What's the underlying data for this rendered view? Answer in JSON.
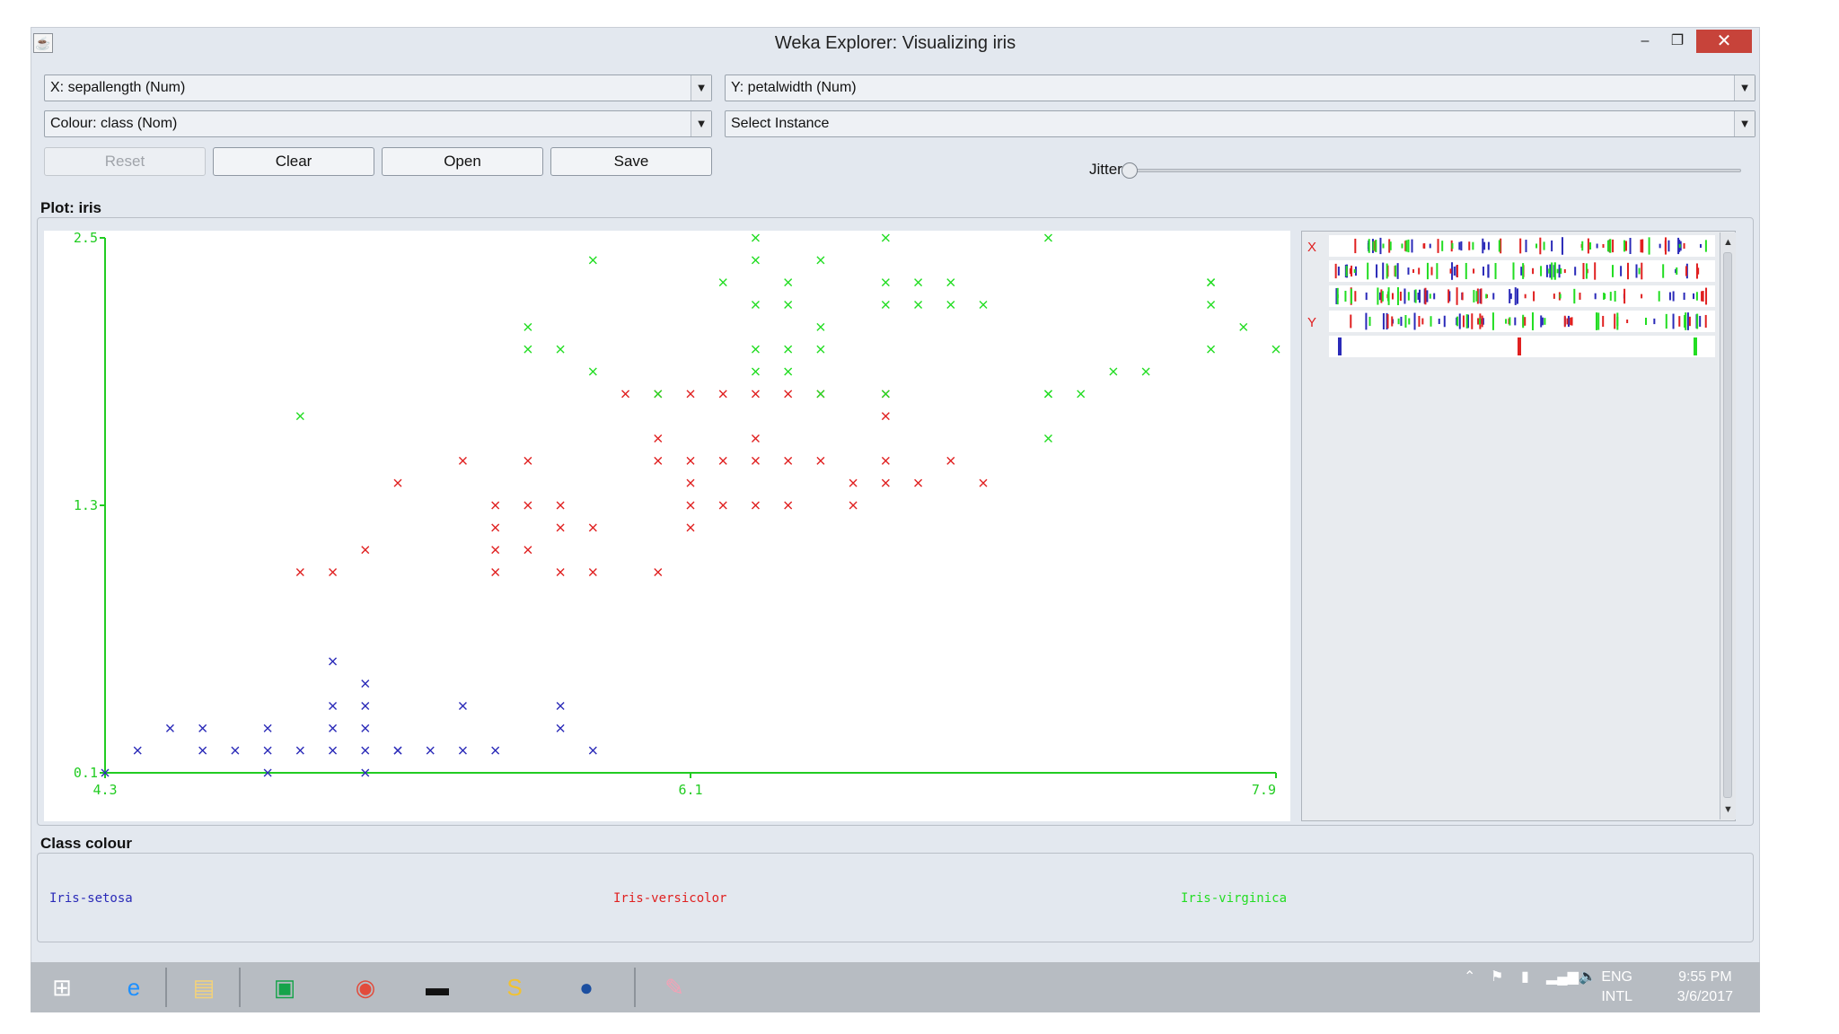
{
  "window": {
    "title": "Weka Explorer: Visualizing iris"
  },
  "controls": {
    "x_axis": "X: sepallength (Num)",
    "y_axis": "Y: petalwidth (Num)",
    "colour": "Colour: class (Nom)",
    "instance": "Select Instance",
    "buttons": {
      "reset": "Reset",
      "clear": "Clear",
      "open": "Open",
      "save": "Save"
    },
    "jitter_label": "Jitter",
    "jitter_value": 0
  },
  "plot": {
    "label": "Plot: iris"
  },
  "side": {
    "x_label": "X",
    "y_label": "Y"
  },
  "legend": {
    "title": "Class colour",
    "classes": [
      {
        "name": "Iris-setosa",
        "color": "#2a2ab8"
      },
      {
        "name": "Iris-versicolor",
        "color": "#e02020"
      },
      {
        "name": "Iris-virginica",
        "color": "#22dd22"
      }
    ]
  },
  "colors": {
    "axis": "#22cc22",
    "setosa": "#2a2ab8",
    "versicolor": "#e02020",
    "virginica": "#22dd22"
  },
  "taskbar": {
    "icons": [
      "windows-start-icon",
      "internet-explorer-icon",
      "file-explorer-icon",
      "store-icon",
      "chrome-icon",
      "cmd-icon",
      "slides-icon",
      "weka-bird-icon",
      "paint-icon"
    ],
    "lang": "ENG",
    "lang2": "INTL",
    "time": "9:55 PM",
    "date": "3/6/2017"
  },
  "chart_data": {
    "type": "scatter",
    "xlim": [
      4.3,
      7.9
    ],
    "ylim": [
      0.1,
      2.5
    ],
    "x_ticks": [
      "4.3",
      "6.1",
      "7.9"
    ],
    "y_ticks": [
      "2.5",
      "1.3",
      "0.1"
    ],
    "marker": "x",
    "series": [
      {
        "name": "Iris-setosa",
        "points": [
          [
            4.3,
            0.1
          ],
          [
            4.8,
            0.1
          ],
          [
            5.1,
            0.1
          ],
          [
            5.2,
            0.2
          ],
          [
            4.4,
            0.2
          ],
          [
            4.6,
            0.2
          ],
          [
            4.7,
            0.2
          ],
          [
            4.8,
            0.2
          ],
          [
            4.9,
            0.2
          ],
          [
            5.0,
            0.2
          ],
          [
            5.1,
            0.2
          ],
          [
            5.2,
            0.2
          ],
          [
            5.3,
            0.2
          ],
          [
            5.4,
            0.2
          ],
          [
            5.5,
            0.2
          ],
          [
            5.8,
            0.2
          ],
          [
            4.5,
            0.3
          ],
          [
            4.6,
            0.3
          ],
          [
            4.8,
            0.3
          ],
          [
            5.0,
            0.3
          ],
          [
            5.1,
            0.3
          ],
          [
            5.7,
            0.3
          ],
          [
            5.0,
            0.4
          ],
          [
            5.1,
            0.4
          ],
          [
            5.4,
            0.4
          ],
          [
            5.7,
            0.4
          ],
          [
            5.1,
            0.5
          ],
          [
            5.0,
            0.6
          ]
        ]
      },
      {
        "name": "Iris-versicolor",
        "points": [
          [
            4.9,
            1.0
          ],
          [
            5.0,
            1.0
          ],
          [
            5.5,
            1.0
          ],
          [
            5.7,
            1.0
          ],
          [
            5.8,
            1.0
          ],
          [
            6.0,
            1.0
          ],
          [
            5.1,
            1.1
          ],
          [
            5.5,
            1.1
          ],
          [
            5.6,
            1.1
          ],
          [
            5.5,
            1.2
          ],
          [
            5.7,
            1.2
          ],
          [
            5.8,
            1.2
          ],
          [
            6.1,
            1.2
          ],
          [
            5.5,
            1.3
          ],
          [
            5.6,
            1.3
          ],
          [
            5.7,
            1.3
          ],
          [
            6.1,
            1.3
          ],
          [
            6.2,
            1.3
          ],
          [
            6.3,
            1.3
          ],
          [
            6.4,
            1.3
          ],
          [
            6.6,
            1.3
          ],
          [
            5.2,
            1.4
          ],
          [
            6.1,
            1.4
          ],
          [
            6.6,
            1.4
          ],
          [
            6.7,
            1.4
          ],
          [
            6.8,
            1.4
          ],
          [
            7.0,
            1.4
          ],
          [
            5.4,
            1.5
          ],
          [
            5.6,
            1.5
          ],
          [
            6.0,
            1.5
          ],
          [
            6.1,
            1.5
          ],
          [
            6.2,
            1.5
          ],
          [
            6.3,
            1.5
          ],
          [
            6.4,
            1.5
          ],
          [
            6.5,
            1.5
          ],
          [
            6.7,
            1.5
          ],
          [
            6.9,
            1.5
          ],
          [
            6.0,
            1.6
          ],
          [
            6.3,
            1.6
          ],
          [
            6.7,
            1.7
          ],
          [
            5.9,
            1.8
          ],
          [
            6.0,
            1.8
          ],
          [
            6.1,
            1.8
          ],
          [
            6.2,
            1.8
          ],
          [
            6.3,
            1.8
          ],
          [
            6.4,
            1.8
          ],
          [
            6.5,
            1.8
          ],
          [
            6.7,
            1.8
          ]
        ]
      },
      {
        "name": "Iris-virginica",
        "points": [
          [
            4.9,
            1.7
          ],
          [
            6.0,
            1.8
          ],
          [
            7.2,
            1.6
          ],
          [
            7.2,
            1.8
          ],
          [
            7.3,
            1.8
          ],
          [
            7.5,
            1.9
          ],
          [
            5.6,
            2.0
          ],
          [
            5.7,
            2.0
          ],
          [
            5.8,
            1.9
          ],
          [
            6.3,
            1.9
          ],
          [
            6.4,
            1.9
          ],
          [
            6.5,
            1.8
          ],
          [
            6.7,
            1.8
          ],
          [
            7.2,
            1.8
          ],
          [
            5.6,
            2.1
          ],
          [
            6.3,
            2.0
          ],
          [
            6.4,
            2.0
          ],
          [
            6.5,
            2.0
          ],
          [
            7.9,
            2.0
          ],
          [
            7.8,
            2.1
          ],
          [
            7.7,
            2.0
          ],
          [
            7.4,
            1.9
          ],
          [
            7.0,
            2.2
          ],
          [
            6.4,
            2.2
          ],
          [
            6.5,
            2.1
          ],
          [
            6.9,
            2.2
          ],
          [
            6.8,
            2.2
          ],
          [
            7.7,
            2.2
          ],
          [
            6.7,
            2.2
          ],
          [
            6.3,
            2.2
          ],
          [
            7.7,
            2.3
          ],
          [
            6.7,
            2.3
          ],
          [
            6.8,
            2.3
          ],
          [
            6.9,
            2.3
          ],
          [
            6.4,
            2.3
          ],
          [
            6.3,
            2.4
          ],
          [
            6.5,
            2.4
          ],
          [
            5.8,
            2.4
          ],
          [
            7.7,
            2.3
          ],
          [
            6.2,
            2.3
          ],
          [
            6.3,
            2.5
          ],
          [
            6.7,
            2.5
          ],
          [
            7.2,
            2.5
          ]
        ]
      }
    ]
  }
}
